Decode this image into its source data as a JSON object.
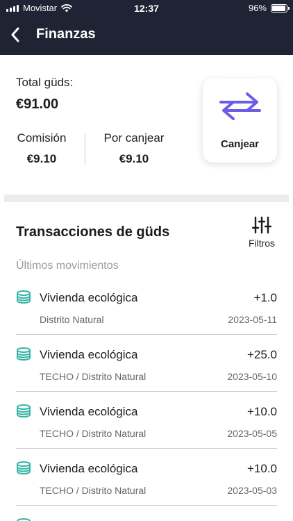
{
  "status_bar": {
    "carrier": "Movistar",
    "time": "12:37",
    "battery": "96%",
    "battery_level": 0.96
  },
  "nav": {
    "title": "Finanzas",
    "back_icon": "chevron-left-icon"
  },
  "balance": {
    "total_label": "Total güds:",
    "total_value": "€91.00",
    "commission_label": "Comisión",
    "commission_value": "€9.10",
    "pending_label": "Por canjear",
    "pending_value": "€9.10",
    "redeem_label": "Canjear",
    "redeem_icon": "exchange-arrows-icon"
  },
  "transactions": {
    "title": "Transacciones de güds",
    "filters_label": "Filtros",
    "filters_icon": "sliders-icon",
    "recent_label": "Últimos movimientos",
    "items": [
      {
        "name": "Vivienda ecológica",
        "subtitle": "Distrito Natural",
        "amount": "+1.0",
        "date": "2023-05-11",
        "icon": "coins-icon"
      },
      {
        "name": "Vivienda ecológica",
        "subtitle": "TECHO / Distrito Natural",
        "amount": "+25.0",
        "date": "2023-05-10",
        "icon": "coins-icon"
      },
      {
        "name": "Vivienda ecológica",
        "subtitle": "TECHO / Distrito Natural",
        "amount": "+10.0",
        "date": "2023-05-05",
        "icon": "coins-icon"
      },
      {
        "name": "Vivienda ecológica",
        "subtitle": "TECHO / Distrito Natural",
        "amount": "+10.0",
        "date": "2023-05-03",
        "icon": "coins-icon"
      }
    ]
  },
  "colors": {
    "header_bg": "#1e2433",
    "accent_purple": "#6c5ce7",
    "coin_teal": "#35b5a6"
  }
}
